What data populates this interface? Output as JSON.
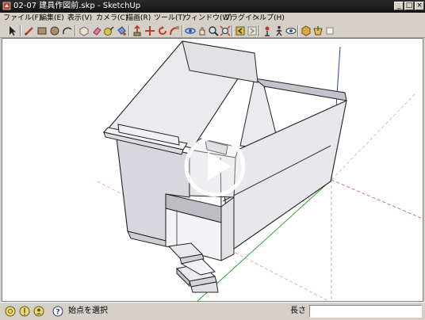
{
  "window": {
    "title": "02-07 建具作図前.skp - SketchUp",
    "controls": {
      "minimize": "_",
      "maximize": "□",
      "close": "×"
    }
  },
  "menu": [
    {
      "label": "ファイル(F)"
    },
    {
      "label": "編集(E)"
    },
    {
      "label": "表示(V)"
    },
    {
      "label": "カメラ(C)"
    },
    {
      "label": "描画(R)"
    },
    {
      "label": "ツール(T)"
    },
    {
      "label": "ウィンドウ(W)"
    },
    {
      "label": "プラグイン"
    },
    {
      "label": "ヘルプ(H)"
    }
  ],
  "toolbar": {
    "tools": [
      "select-icon",
      "pencil-line-icon",
      "rectangle-icon",
      "circle-icon",
      "arc-icon",
      "make-component-icon",
      "eraser-icon",
      "tape-measure-icon",
      "paint-bucket-icon",
      "push-pull-icon",
      "move-icon",
      "rotate-icon",
      "follow-me-icon",
      "orbit-icon",
      "pan-icon",
      "zoom-icon",
      "zoom-extents-icon",
      "prev-view-icon",
      "next-view-icon",
      "position-camera-icon",
      "walk-icon",
      "look-around-icon",
      "get-models-icon",
      "share-model-icon",
      "components-icon"
    ]
  },
  "viewport": {
    "play_overlay": "play-button-icon"
  },
  "status": {
    "hint": "始点を選択",
    "measurements_label": "長さ",
    "measurements_value": ""
  }
}
